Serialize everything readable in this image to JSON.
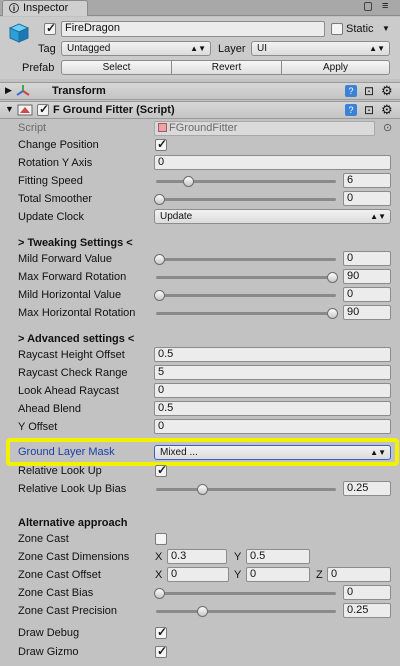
{
  "tab": {
    "title": "Inspector"
  },
  "gameobject": {
    "name": "FireDragon",
    "static_label": "Static",
    "tag_label": "Tag",
    "tag_value": "Untagged",
    "layer_label": "Layer",
    "layer_value": "UI",
    "prefab_label": "Prefab",
    "select_label": "Select",
    "revert_label": "Revert",
    "apply_label": "Apply"
  },
  "transform": {
    "title": "Transform"
  },
  "component": {
    "title": "F Ground Fitter (Script)",
    "script_label": "Script",
    "script_value": "FGroundFitter"
  },
  "fields": {
    "change_position": "Change Position",
    "rotation_y_axis": "Rotation Y Axis",
    "rotation_y_axis_value": "0",
    "fitting_speed": "Fitting Speed",
    "fitting_speed_value": "6",
    "total_smoother": "Total Smoother",
    "total_smoother_value": "0",
    "update_clock": "Update Clock",
    "update_clock_value": "Update",
    "tweaking_header": "> Tweaking Settings <",
    "mild_forward": "Mild Forward Value",
    "mild_forward_value": "0",
    "max_forward": "Max Forward Rotation",
    "max_forward_value": "90",
    "mild_horizontal": "Mild Horizontal Value",
    "mild_horizontal_value": "0",
    "max_horizontal": "Max Horizontal Rotation",
    "max_horizontal_value": "90",
    "advanced_header": "> Advanced settings <",
    "raycast_height": "Raycast Height Offset",
    "raycast_height_value": "0.5",
    "raycast_check": "Raycast Check Range",
    "raycast_check_value": "5",
    "look_ahead": "Look Ahead Raycast",
    "look_ahead_value": "0",
    "ahead_blend": "Ahead Blend",
    "ahead_blend_value": "0.5",
    "y_offset": "Y Offset",
    "y_offset_value": "0",
    "ground_layer": "Ground Layer Mask",
    "ground_layer_value": "Mixed ...",
    "relative_look_up": "Relative Look Up",
    "relative_look_up_bias": "Relative Look Up Bias",
    "relative_look_up_bias_value": "0.25",
    "alt_header": "Alternative approach",
    "zone_cast": "Zone Cast",
    "zone_dims": "Zone Cast Dimensions",
    "zone_dims_x_label": "X",
    "zone_dims_x": "0.3",
    "zone_dims_y_label": "Y",
    "zone_dims_y": "0.5",
    "zone_offset": "Zone Cast Offset",
    "zone_offset_x_label": "X",
    "zone_offset_x": "0",
    "zone_offset_y_label": "Y",
    "zone_offset_y": "0",
    "zone_offset_z_label": "Z",
    "zone_offset_z": "0",
    "zone_bias": "Zone Cast Bias",
    "zone_bias_value": "0",
    "zone_precision": "Zone Cast Precision",
    "zone_precision_value": "0.25",
    "draw_debug": "Draw Debug",
    "draw_gizmo": "Draw Gizmo"
  },
  "sliders": {
    "fitting_speed": 0.17,
    "total_smoother": 0.0,
    "mild_forward": 0.0,
    "max_forward": 1.0,
    "mild_horizontal": 0.0,
    "max_horizontal": 1.0,
    "relative_look_up_bias": 0.25,
    "zone_bias": 0.0,
    "zone_precision": 0.25
  },
  "checks": {
    "glyph": "✓"
  },
  "colors": {
    "highlight": "#f2f200",
    "accent_label": "#1a3fa8"
  }
}
